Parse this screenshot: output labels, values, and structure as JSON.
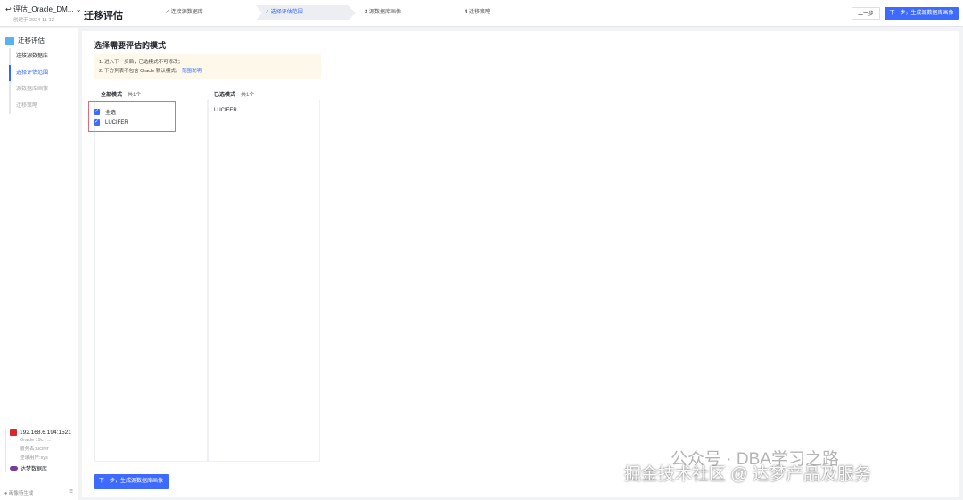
{
  "project": {
    "name": "评估_Oracle_DM...",
    "created": "创建于 2024-11-12"
  },
  "app_title": "迁移评估",
  "steps": [
    {
      "label": "连接源数据库",
      "mark": "✓"
    },
    {
      "label": "选择评估范围",
      "mark": "✓"
    },
    {
      "label": "源数据库画像",
      "mark": "3"
    },
    {
      "label": "迁移策略",
      "mark": "4"
    }
  ],
  "top_buttons": {
    "prev": "上一步",
    "next": "下一步，生成源数据库画像"
  },
  "sidebar": {
    "header": "迁移评估",
    "items": [
      "连接源数据库",
      "选择评估范围",
      "源数据库画像",
      "迁移策略"
    ],
    "db": {
      "ip": "192.168.6.194:1521",
      "version": "Oracle 19c | ...",
      "service": "服务名:lucifer",
      "user": "登录用户:sys",
      "target": "达梦数据库"
    },
    "footer": "画像待生成"
  },
  "main": {
    "title": "选择需要评估的模式",
    "notice": {
      "line1": "1. 进入下一步后，已选模式不可修改；",
      "line2": "2. 下方列表不包含 Oracle 默认模式。",
      "link": "范围说明"
    },
    "all": {
      "label": "全部模式",
      "count": "共1个",
      "select_all": "全选",
      "items": [
        "LUCIFER"
      ]
    },
    "selected": {
      "label": "已选模式",
      "count": "共1个",
      "items": [
        "LUCIFER"
      ]
    },
    "next_button": "下一步，生成源数据库画像"
  },
  "watermark": {
    "line1": "公众号 · DBA学习之路",
    "line2": "掘金技术社区 @ 达梦产品及服务"
  }
}
